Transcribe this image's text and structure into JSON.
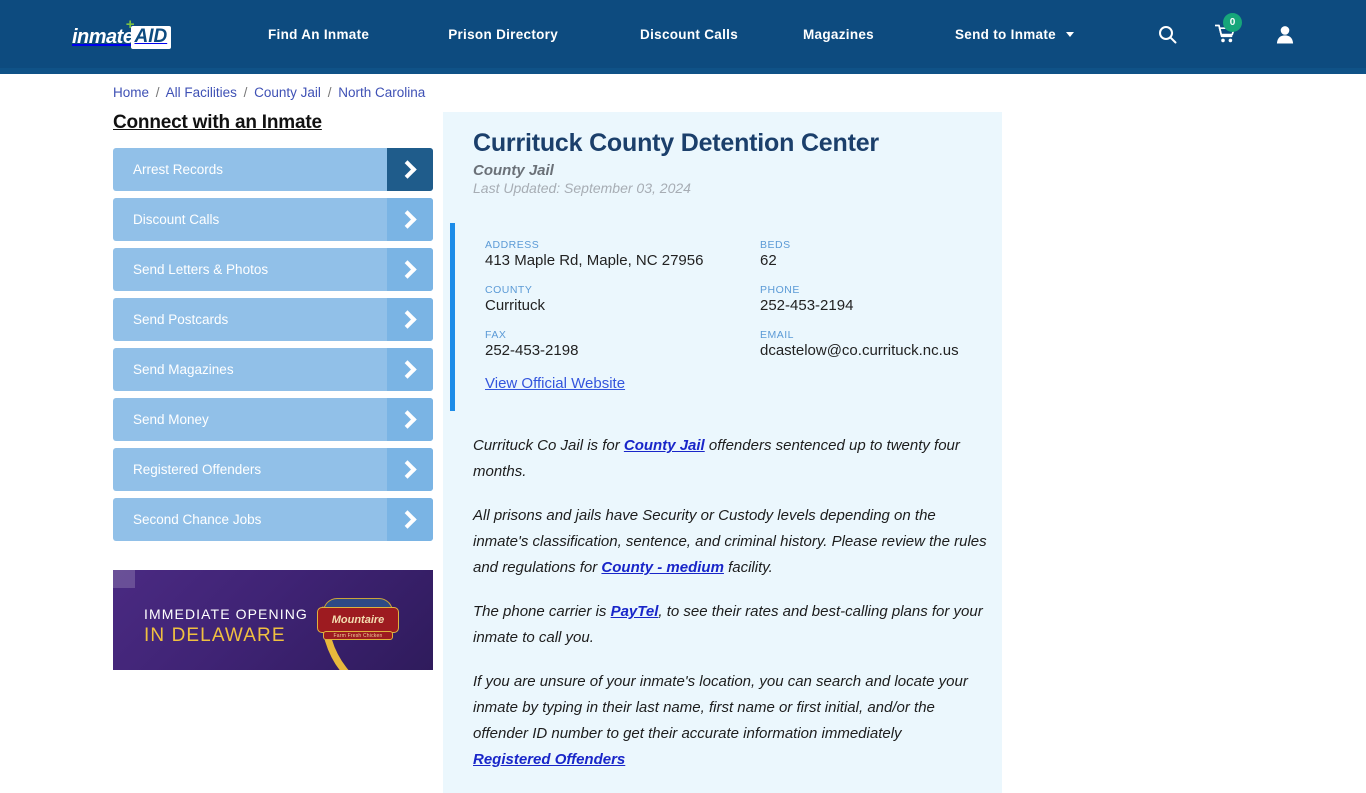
{
  "header": {
    "logo": {
      "part1": "inmate",
      "part2": "AID",
      "plus": "+"
    },
    "nav": [
      {
        "label": "Find An Inmate"
      },
      {
        "label": "Prison Directory"
      },
      {
        "label": "Discount Calls"
      },
      {
        "label": "Magazines"
      },
      {
        "label": "Send to Inmate",
        "has_caret": true
      }
    ],
    "icons": {
      "search": "search-icon",
      "cart": "cart-icon",
      "cart_count": "0",
      "account": "user-icon"
    },
    "colors": {
      "background": "#0d4b7f",
      "badge": "#17a67a"
    }
  },
  "breadcrumb": {
    "items": [
      "Home",
      "All Facilities",
      "County Jail",
      "North Carolina"
    ],
    "separator": "/"
  },
  "sidebar": {
    "title": "Connect with an Inmate",
    "items": [
      {
        "label": "Arrest Records",
        "active": true
      },
      {
        "label": "Discount Calls",
        "active": false
      },
      {
        "label": "Send Letters & Photos",
        "active": false
      },
      {
        "label": "Send Postcards",
        "active": false
      },
      {
        "label": "Send Magazines",
        "active": false
      },
      {
        "label": "Send Money",
        "active": false
      },
      {
        "label": "Registered Offenders",
        "active": false
      },
      {
        "label": "Second Chance Jobs",
        "active": false
      }
    ]
  },
  "ad": {
    "line1": "IMMEDIATE OPENING",
    "line2": "IN DELAWARE",
    "brand": "Mountaire",
    "brand_sub": "Farm Fresh Chicken"
  },
  "facility": {
    "name": "Currituck County Detention Center",
    "type": "County Jail",
    "last_updated": "Last Updated: September 03, 2024",
    "info": [
      {
        "label": "ADDRESS",
        "value": "413 Maple Rd, Maple, NC 27956"
      },
      {
        "label": "BEDS",
        "value": "62"
      },
      {
        "label": "COUNTY",
        "value": "Currituck"
      },
      {
        "label": "PHONE",
        "value": "252-453-2194"
      },
      {
        "label": "FAX",
        "value": "252-453-2198"
      },
      {
        "label": "EMAIL",
        "value": "dcastelow@co.currituck.nc.us"
      }
    ],
    "official_website_link": "View Official Website",
    "paragraphs": {
      "p1_a": "Currituck Co Jail is for ",
      "p1_link": "County Jail",
      "p1_b": " offenders sentenced up to twenty four months.",
      "p2_a": "All prisons and jails have Security or Custody levels depending on the inmate's classification, sentence, and criminal history. Please review the rules and regulations for ",
      "p2_link": "County - medium",
      "p2_b": " facility.",
      "p3_a": "The phone carrier is ",
      "p3_link": "PayTel",
      "p3_b": ", to see their rates and best-calling plans for your inmate to call you.",
      "p4_a": "If you are unsure of your inmate's location, you can search and locate your inmate by typing in their last name, first name or first initial, and/or the offender ID number to get their accurate information immediately ",
      "p4_link": "Registered Offenders"
    }
  }
}
